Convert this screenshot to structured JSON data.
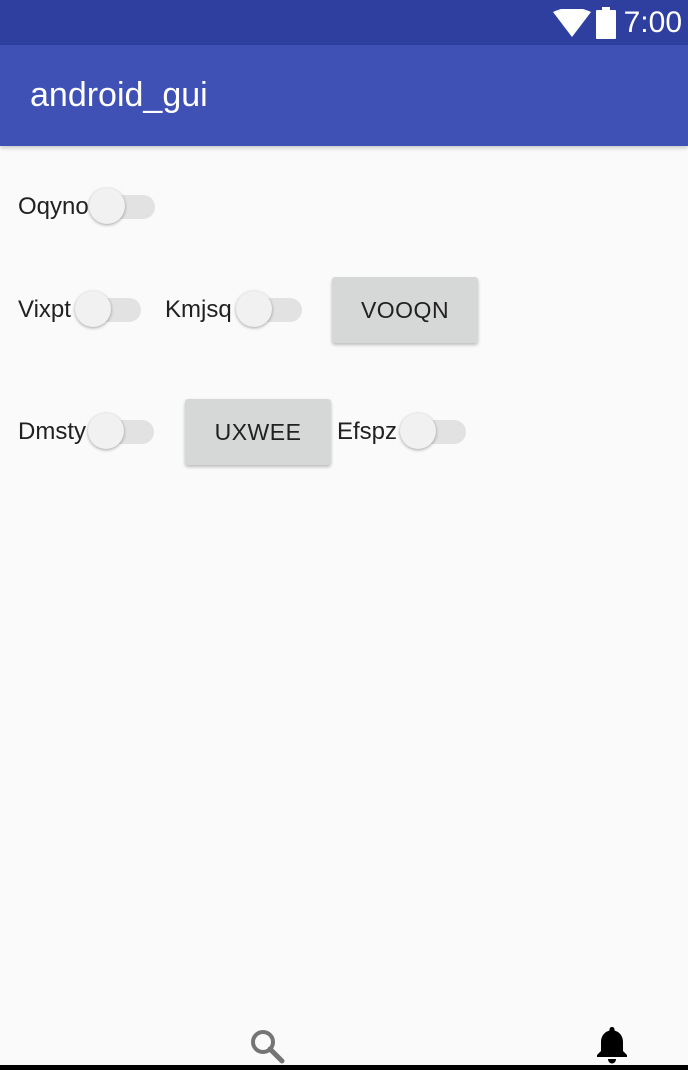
{
  "status_bar": {
    "time": "7:00",
    "wifi_icon": "wifi-icon",
    "battery_icon": "battery-icon",
    "background": "#2f3fa0"
  },
  "app_bar": {
    "title": "android_gui",
    "background": "#3f51b5"
  },
  "row1": {
    "oqyno_label": "Oqyno",
    "oqyno_switch_on": false
  },
  "row2": {
    "vixpt_label": "Vixpt",
    "vixpt_switch_on": false,
    "kmjsq_label": "Kmjsq",
    "kmjsq_switch_on": false,
    "vooqn_button": "VOOQN"
  },
  "row3": {
    "dmsty_label": "Dmsty",
    "dmsty_switch_on": false,
    "uxwee_button": "UXWEE",
    "efspz_label": "Efspz",
    "efspz_switch_on": false
  },
  "bottom_bar": {
    "search_icon": "search-icon",
    "notification_icon": "bell-icon"
  }
}
